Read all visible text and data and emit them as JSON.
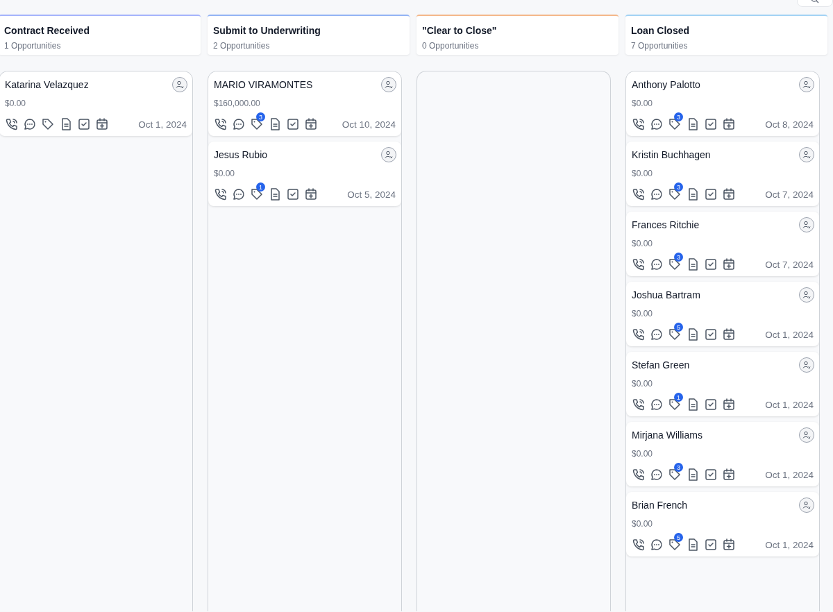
{
  "columns": [
    {
      "title": "Contract Received",
      "count": "1 Opportunities",
      "color": "#a5b4fc",
      "cards": [
        {
          "name": "Katarina Velazquez",
          "amount": "$0.00",
          "date": "Oct 1, 2024"
        }
      ]
    },
    {
      "title": "Submit to Underwriting",
      "count": "2 Opportunities",
      "color": "#93b4f5",
      "cards": [
        {
          "name": "MARIO VIRAMONTES",
          "amount": "$160,000.00",
          "tag_count": "3",
          "date": "Oct 10, 2024"
        },
        {
          "name": "Jesus Rubio",
          "amount": "$0.00",
          "tag_count": "1",
          "date": "Oct 5, 2024"
        }
      ]
    },
    {
      "title": "\"Clear to Close\"",
      "count": "0 Opportunities",
      "color": "#f5b88a"
    },
    {
      "title": "Loan Closed",
      "count": "7 Opportunities",
      "color": "#a3d3f5",
      "cards": [
        {
          "name": "Anthony Palotto",
          "amount": "$0.00",
          "tag_count": "3",
          "date": "Oct 8, 2024"
        },
        {
          "name": "Kristin Buchhagen",
          "amount": "$0.00",
          "tag_count": "3",
          "date": "Oct 7, 2024"
        },
        {
          "name": "Frances Ritchie",
          "amount": "$0.00",
          "tag_count": "3",
          "date": "Oct 7, 2024"
        },
        {
          "name": "Joshua Bartram",
          "amount": "$0.00",
          "tag_count": "5",
          "date": "Oct 1, 2024"
        },
        {
          "name": "Stefan Green",
          "amount": "$0.00",
          "tag_count": "1",
          "date": "Oct 1, 2024"
        },
        {
          "name": "Mirjana Williams",
          "amount": "$0.00",
          "tag_count": "3",
          "date": "Oct 1, 2024"
        },
        {
          "name": "Brian French",
          "amount": "$0.00",
          "tag_count": "5",
          "date": "Oct 1, 2024"
        }
      ]
    }
  ]
}
